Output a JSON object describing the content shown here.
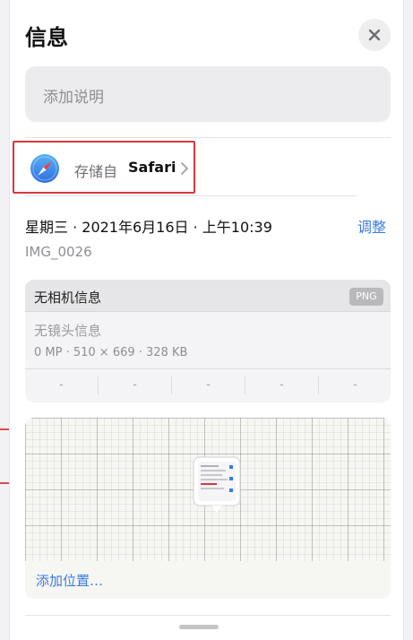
{
  "panel": {
    "title": "信息",
    "close_icon": "close-icon",
    "caption_placeholder": "添加说明"
  },
  "source": {
    "label": "存储自",
    "app": "Safari",
    "icon": "safari-compass-icon",
    "chevron": "chevron-right-icon",
    "highlight_color": "#d9383e"
  },
  "datetime": {
    "text": "星期三 · 2021年6月16日 · 上午10:39",
    "adjust_label": "调整"
  },
  "file": {
    "name": "IMG_0026"
  },
  "camera": {
    "title": "无相机信息",
    "format": "PNG",
    "lens": "无镜头信息",
    "specs": "0 MP · 510 × 669 · 328 KB",
    "exif": [
      "-",
      "-",
      "-",
      "-",
      "-"
    ]
  },
  "map": {
    "add_location_label": "添加位置…"
  },
  "colors": {
    "accent": "#3a7be0",
    "background": "#ffffff"
  }
}
